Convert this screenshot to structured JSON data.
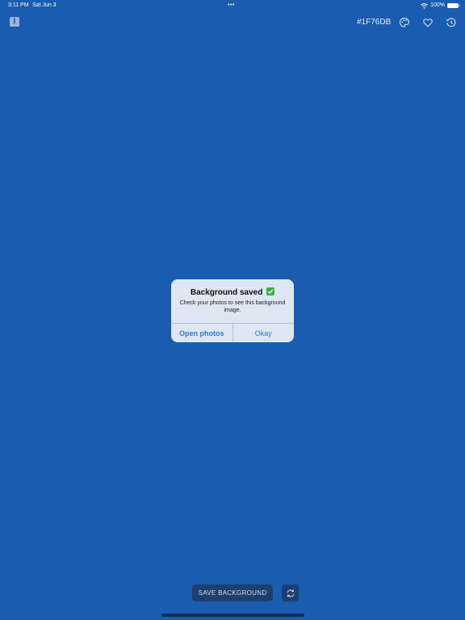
{
  "status_bar": {
    "time": "3:11 PM",
    "date": "Sat Jun 3",
    "dots": "•••",
    "battery": "100%"
  },
  "toolbar": {
    "hex_code": "#1F76DB",
    "info_icon": "info-icon",
    "palette_icon": "palette-icon",
    "favorite_icon": "heart-icon",
    "history_icon": "history-icon"
  },
  "alert": {
    "title": "Background saved",
    "message": "Check your photos to see this background image.",
    "open_photos_label": "Open photos",
    "okay_label": "Okay"
  },
  "bottom": {
    "save_label": "SAVE BACKGROUND",
    "refresh_icon": "refresh-icon"
  },
  "colors": {
    "background": "#1A5DB0",
    "accent": "#2c7be5"
  }
}
